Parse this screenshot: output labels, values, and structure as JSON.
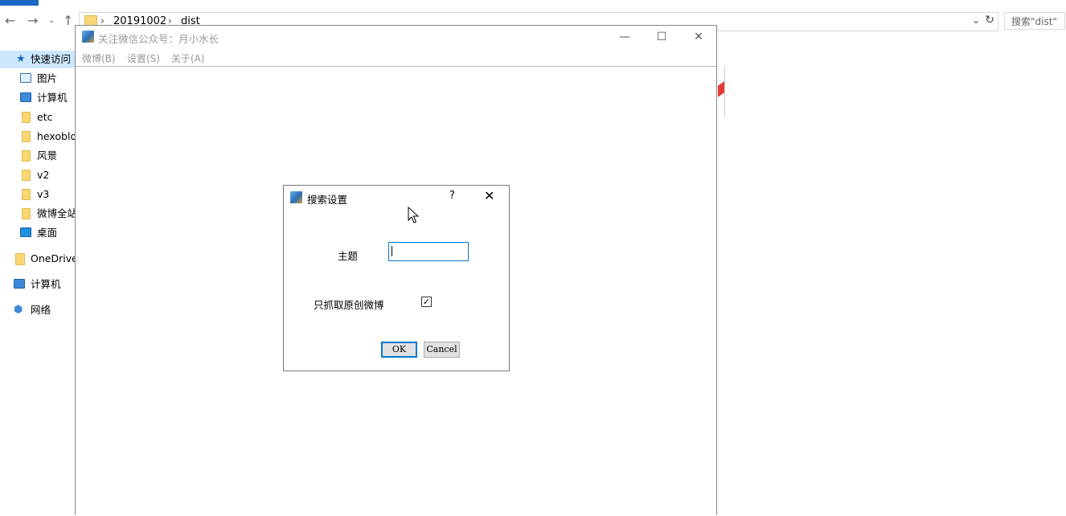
{
  "explorer": {
    "address": {
      "segments": [
        "20191002",
        "dist"
      ],
      "separator": "›"
    },
    "search_placeholder": "搜索\"dist\"",
    "sidebar": {
      "items": [
        {
          "label": "快速访问",
          "icon": "star-icon"
        },
        {
          "label": "图片",
          "icon": "picture-icon"
        },
        {
          "label": "计算机",
          "icon": "computer-icon"
        },
        {
          "label": "etc",
          "icon": "folder-icon"
        },
        {
          "label": "hexoblo",
          "icon": "folder-icon"
        },
        {
          "label": "风景",
          "icon": "folder-icon"
        },
        {
          "label": "v2",
          "icon": "folder-icon"
        },
        {
          "label": "v3",
          "icon": "folder-icon"
        },
        {
          "label": "微博全站",
          "icon": "folder-icon"
        },
        {
          "label": "桌面",
          "icon": "desktop-icon"
        },
        {
          "label": "OneDrive",
          "icon": "folder-icon"
        },
        {
          "label": "计算机",
          "icon": "computer-icon"
        },
        {
          "label": "网络",
          "icon": "network-icon"
        }
      ]
    }
  },
  "app": {
    "title": "关注微信公众号：月小水长",
    "menu": [
      "微博(B)",
      "设置(S)",
      "关于(A)"
    ],
    "window_buttons": {
      "minimize": "—",
      "maximize": "☐",
      "close": "✕"
    }
  },
  "dialog": {
    "title": "搜索设置",
    "help": "?",
    "close": "✕",
    "topic_label": "主题",
    "topic_value": "",
    "original_only_label": "只抓取原创微博",
    "original_only_checked": true,
    "ok_label": "OK",
    "cancel_label": "Cancel"
  },
  "colors": {
    "accent": "#0078d7",
    "selected_bg": "#cce8ff",
    "menu_disabled": "#999999"
  }
}
